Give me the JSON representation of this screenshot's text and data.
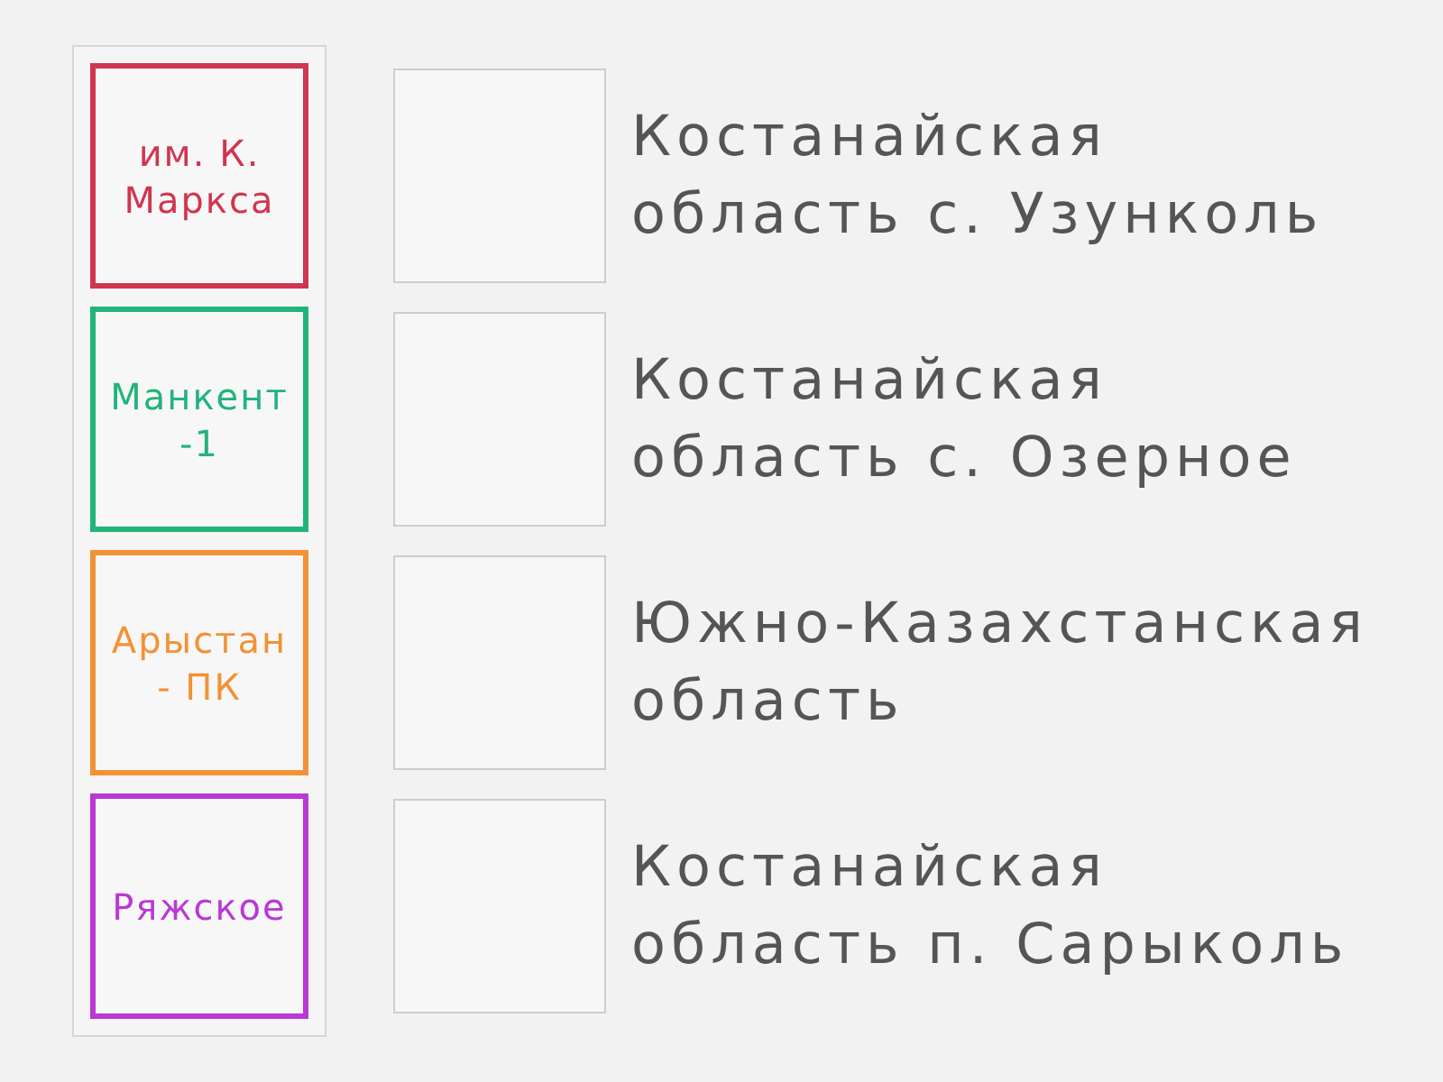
{
  "cards": [
    {
      "text": "им. К. Маркса",
      "color": "#d1354f"
    },
    {
      "text": "Манкент -1",
      "color": "#22b47b"
    },
    {
      "text": "Арыстан - ПК",
      "color": "#f29235"
    },
    {
      "text": "Ряжское",
      "color": "#ba38d5"
    }
  ],
  "targets": [
    {
      "label": "Костанайская область с. Узунколь"
    },
    {
      "label": "Костанайская область с. Озерное"
    },
    {
      "label": "Южно-Казахстанская область"
    },
    {
      "label": "Костанайская область п. Сарыколь"
    }
  ]
}
